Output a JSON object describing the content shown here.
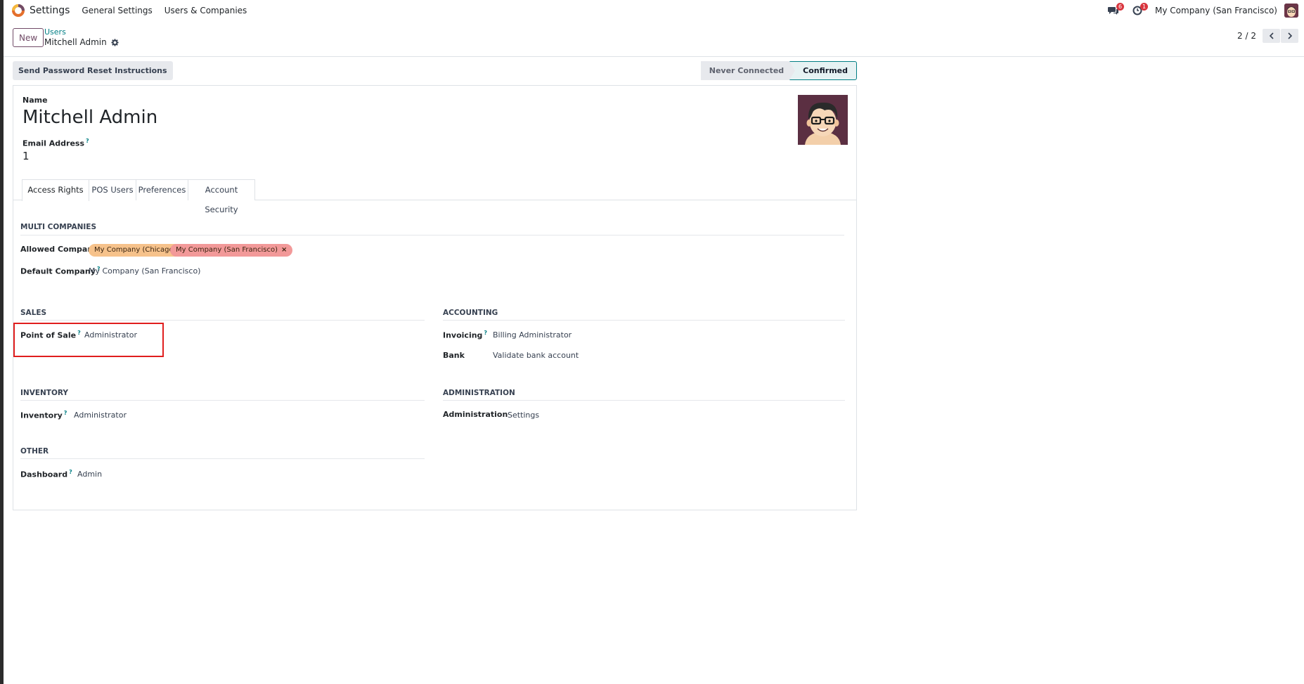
{
  "app": {
    "name": "Settings",
    "menu": [
      "General Settings",
      "Users & Companies"
    ]
  },
  "systray": {
    "messages_count": "6",
    "activities_count": "1",
    "company": "My Company (San Francisco)"
  },
  "control_panel": {
    "new_label": "New",
    "breadcrumb_parent": "Users",
    "breadcrumb_current": "Mitchell Admin",
    "pager": "2 / 2"
  },
  "statusbar": {
    "reset_button": "Send Password Reset Instructions",
    "stages": [
      "Never Connected",
      "Confirmed"
    ],
    "active_stage": "Confirmed"
  },
  "form": {
    "name_label": "Name",
    "name_value": "Mitchell Admin",
    "email_label": "Email Address",
    "tooltip_mark": "?",
    "email_value": "1"
  },
  "tabs": [
    "Access Rights",
    "POS Users",
    "Preferences",
    "Account Security"
  ],
  "access_rights": {
    "multi_companies": {
      "title": "MULTI COMPANIES",
      "allowed_label": "Allowed Companies",
      "allowed_tags": [
        {
          "label": "My Company (Chicago)",
          "color": "#f6c28b"
        },
        {
          "label": "My Company (San Francisco)",
          "color": "#f29999"
        }
      ],
      "default_label": "Default Company",
      "default_value": "My Company (San Francisco)"
    },
    "sales": {
      "title": "SALES",
      "label": "Point of Sale",
      "value": "Administrator"
    },
    "accounting": {
      "title": "ACCOUNTING",
      "invoicing_label": "Invoicing",
      "invoicing_value": "Billing Administrator",
      "bank_label": "Bank",
      "bank_value": "Validate bank account"
    },
    "inventory": {
      "title": "INVENTORY",
      "label": "Inventory",
      "value": "Administrator"
    },
    "administration": {
      "title": "ADMINISTRATION",
      "label": "Administration",
      "value": "Settings"
    },
    "other": {
      "title": "OTHER",
      "label": "Dashboard",
      "value": "Admin"
    }
  },
  "colors": {
    "brand": "#714b67",
    "link": "#017e84",
    "highlight": "#e01e1e"
  }
}
